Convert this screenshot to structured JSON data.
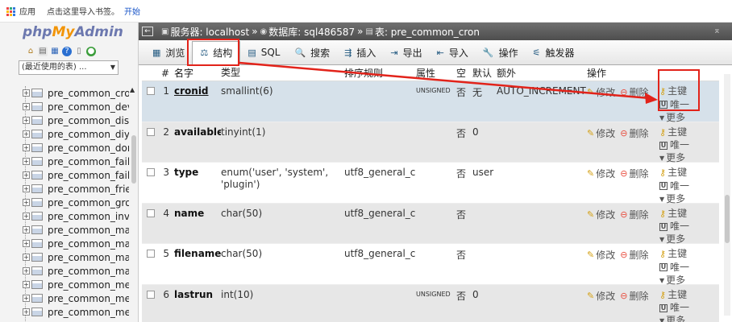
{
  "bookmarks": {
    "apps": "应用",
    "hint": "点击这里导入书签。",
    "start": "开始"
  },
  "left": {
    "logo_php": "php",
    "logo_my": "My",
    "logo_admin": "Admin",
    "recent": "(最近使用的表) ...",
    "tables": [
      "pre_common_cron",
      "pre_common_dev",
      "pre_common_dist",
      "pre_common_diy_",
      "pre_common_don",
      "pre_common_faile",
      "pre_common_faile",
      "pre_common_frier",
      "pre_common_grou",
      "pre_common_invit",
      "pre_common_mag",
      "pre_common_mag",
      "pre_common_mai",
      "pre_common_mai",
      "pre_common_mer",
      "pre_common_mer",
      "pre_common_mer"
    ]
  },
  "breadcrumb": {
    "server": "服务器: localhost",
    "database": "数据库: sql486587",
    "table": "表: pre_common_cron"
  },
  "tabs": [
    {
      "label": "浏览",
      "icon": "browse-icon"
    },
    {
      "label": "结构",
      "icon": "structure-icon"
    },
    {
      "label": "SQL",
      "icon": "sql-icon"
    },
    {
      "label": "搜索",
      "icon": "search-icon"
    },
    {
      "label": "插入",
      "icon": "insert-icon"
    },
    {
      "label": "导出",
      "icon": "export-icon"
    },
    {
      "label": "导入",
      "icon": "import-icon"
    },
    {
      "label": "操作",
      "icon": "wrench-icon"
    },
    {
      "label": "触发器",
      "icon": "trigger-icon"
    }
  ],
  "columns": {
    "num": "#",
    "name": "名字",
    "type": "类型",
    "collation": "排序规则",
    "attributes": "属性",
    "null": "空",
    "default": "默认",
    "extra": "额外",
    "action": "操作"
  },
  "actions": {
    "edit": "修改",
    "drop": "删除",
    "primary": "主键",
    "unique": "唯一",
    "more": "更多"
  },
  "rows": [
    {
      "num": "1",
      "name": "cronid",
      "type": "smallint(6)",
      "collation": "",
      "attributes": "UNSIGNED",
      "null": "否",
      "default": "无",
      "extra": "AUTO_INCREMENT"
    },
    {
      "num": "2",
      "name": "available",
      "type": "tinyint(1)",
      "collation": "",
      "attributes": "",
      "null": "否",
      "default": "0",
      "extra": ""
    },
    {
      "num": "3",
      "name": "type",
      "type": "enum('user', 'system', 'plugin')",
      "collation": "utf8_general_ci",
      "attributes": "",
      "null": "否",
      "default": "user",
      "extra": ""
    },
    {
      "num": "4",
      "name": "name",
      "type": "char(50)",
      "collation": "utf8_general_ci",
      "attributes": "",
      "null": "否",
      "default": "",
      "extra": ""
    },
    {
      "num": "5",
      "name": "filename",
      "type": "char(50)",
      "collation": "utf8_general_ci",
      "attributes": "",
      "null": "否",
      "default": "",
      "extra": ""
    },
    {
      "num": "6",
      "name": "lastrun",
      "type": "int(10)",
      "collation": "",
      "attributes": "UNSIGNED",
      "null": "否",
      "default": "0",
      "extra": ""
    }
  ],
  "colors": {
    "annotation": "#e2231a",
    "breadcrumb_bg": "#5c5c5c",
    "selected_row": "#d6e1ea"
  }
}
